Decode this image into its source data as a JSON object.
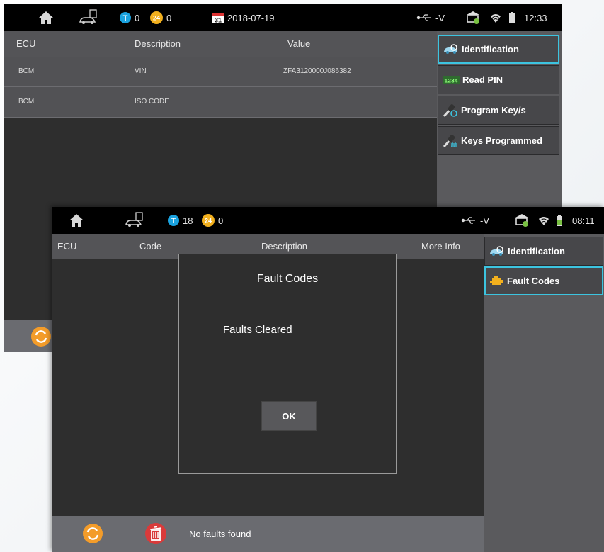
{
  "screen1": {
    "status": {
      "t_count": "0",
      "dtc_count": "0",
      "date": "2018-07-19",
      "date_icon_day": "31",
      "usb_text": "-V",
      "time": "12:33"
    },
    "table": {
      "headers": [
        "ECU",
        "Description",
        "Value"
      ],
      "rows": [
        {
          "ecu": "BCM",
          "description": "VIN",
          "value": "ZFA3120000J086382"
        },
        {
          "ecu": "BCM",
          "description": "ISO CODE",
          "value": ""
        }
      ]
    },
    "sidebar": [
      {
        "label": "Identification",
        "icon": "car-search-icon",
        "active": true
      },
      {
        "label": "Read PIN",
        "icon": "pin-display-icon",
        "active": false
      },
      {
        "label": "Program Key/s",
        "icon": "key-program-icon",
        "active": false
      },
      {
        "label": "Keys Programmed",
        "icon": "key-hash-icon",
        "active": false
      }
    ],
    "pin_icon_text": "1234"
  },
  "screen2": {
    "status": {
      "t_count": "18",
      "dtc_count": "0",
      "usb_text": "-V",
      "time": "08:11"
    },
    "table": {
      "headers": [
        "ECU",
        "Code",
        "Description",
        "More Info"
      ]
    },
    "sidebar": [
      {
        "label": "Identification",
        "icon": "car-search-icon",
        "active": false
      },
      {
        "label": "Fault Codes",
        "icon": "engine-icon",
        "active": true
      }
    ],
    "dialog": {
      "title": "Fault Codes",
      "message": "Faults Cleared",
      "ok_label": "OK"
    },
    "bottom": {
      "status_text": "No faults found"
    }
  },
  "icons": {
    "t_badge_letter": "T",
    "dtc_badge_text": "24"
  },
  "colors": {
    "accent_active": "#3cc4e0",
    "badge_blue": "#1aa3e0",
    "badge_orange": "#f2b01e",
    "refresh_orange": "#f39c2a",
    "trash_red": "#d93a3a"
  }
}
